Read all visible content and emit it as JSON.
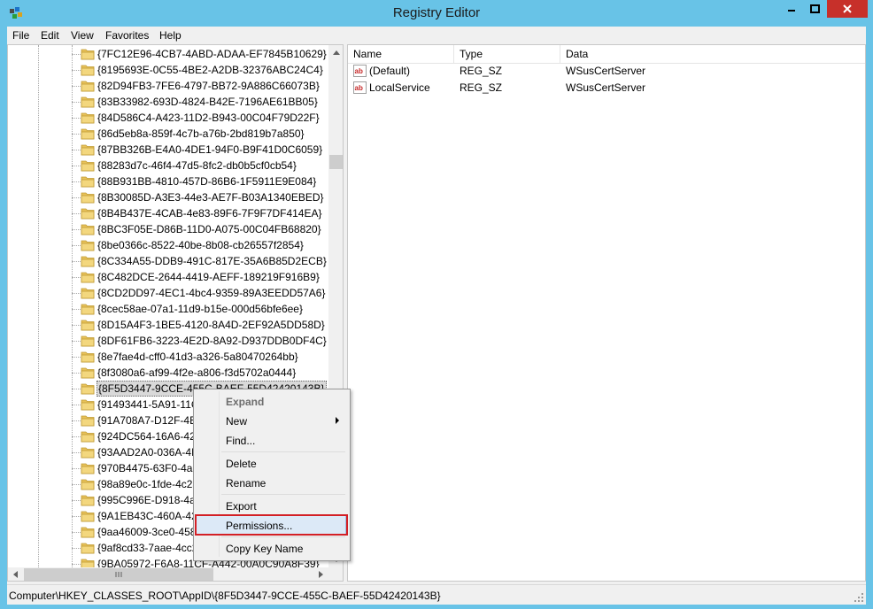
{
  "window": {
    "title": "Registry Editor"
  },
  "menubar": [
    "File",
    "Edit",
    "View",
    "Favorites",
    "Help"
  ],
  "tree": {
    "items": [
      "{7FC12E96-4CB7-4ABD-ADAA-EF7845B10629}",
      "{8195693E-0C55-4BE2-A2DB-32376ABC24C4}",
      "{82D94FB3-7FE6-4797-BB72-9A886C66073B}",
      "{83B33982-693D-4824-B42E-7196AE61BB05}",
      "{84D586C4-A423-11D2-B943-00C04F79D22F}",
      "{86d5eb8a-859f-4c7b-a76b-2bd819b7a850}",
      "{87BB326B-E4A0-4DE1-94F0-B9F41D0C6059}",
      "{88283d7c-46f4-47d5-8fc2-db0b5cf0cb54}",
      "{88B931BB-4810-457D-86B6-1F5911E9E084}",
      "{8B30085D-A3E3-44e3-AE7F-B03A1340EBED}",
      "{8B4B437E-4CAB-4e83-89F6-7F9F7DF414EA}",
      "{8BC3F05E-D86B-11D0-A075-00C04FB68820}",
      "{8be0366c-8522-40be-8b08-cb26557f2854}",
      "{8C334A55-DDB9-491C-817E-35A6B85D2ECB}",
      "{8C482DCE-2644-4419-AEFF-189219F916B9}",
      "{8CD2DD97-4EC1-4bc4-9359-89A3EEDD57A6}",
      "{8cec58ae-07a1-11d9-b15e-000d56bfe6ee}",
      "{8D15A4F3-1BE5-4120-8A4D-2EF92A5DD58D}",
      "{8DF61FB6-3223-4E2D-8A92-D937DDB0DF4C}",
      "{8e7fae4d-cff0-41d3-a326-5a80470264bb}",
      "{8f3080a6-af99-4f2e-a806-f3d5702a0444}",
      "{8F5D3447-9CCE-455C-BAEF-55D42420143B}",
      "{91493441-5A91-11CF",
      "{91A708A7-D12F-4B0",
      "{924DC564-16A6-42E",
      "{93AAD2A0-036A-4B",
      "{970B4475-63F0-4aa4",
      "{98a89e0c-1fde-4c2a",
      "{995C996E-D918-4a8",
      "{9A1EB43C-460A-42B",
      "{9aa46009-3ce0-458a",
      "{9af8cd33-7aae-4cc2",
      "{9BA05972-F6A8-11CF-A442-00A0C90A8F39}"
    ],
    "selected_index": 21
  },
  "list": {
    "columns": [
      "Name",
      "Type",
      "Data"
    ],
    "rows": [
      {
        "name": "(Default)",
        "type": "REG_SZ",
        "data": "WSusCertServer"
      },
      {
        "name": "LocalService",
        "type": "REG_SZ",
        "data": "WSusCertServer"
      }
    ]
  },
  "statusbar": {
    "path": "Computer\\HKEY_CLASSES_ROOT\\AppID\\{8F5D3447-9CCE-455C-BAEF-55D42420143B}"
  },
  "context_menu": {
    "items": [
      "Expand",
      "New",
      "Find...",
      "Delete",
      "Rename",
      "Export",
      "Permissions...",
      "Copy Key Name"
    ]
  },
  "colors": {
    "titlebar": "#68c3e7",
    "close": "#c7302a",
    "highlight_box": "#d32026",
    "menu_highlight": "#dce9f7"
  }
}
